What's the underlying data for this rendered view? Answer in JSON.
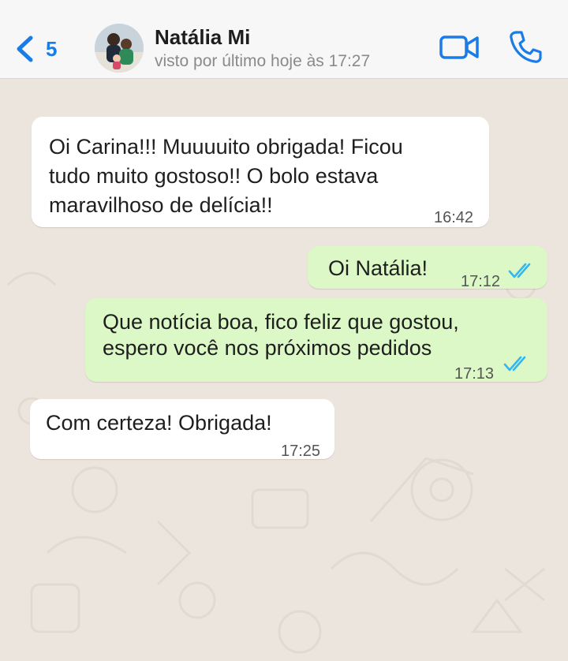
{
  "header": {
    "back_count": "5",
    "contact_name": "Natália Mi",
    "status": "visto por último hoje às 17:27"
  },
  "colors": {
    "accent": "#1a7ce6",
    "incoming_bubble": "#ffffff",
    "outgoing_bubble": "#dcf8c6",
    "chat_background": "#ece5dd",
    "read_ticks": "#34b7f1"
  },
  "icons": {
    "back": "chevron-left-icon",
    "video": "video-camera-icon",
    "call": "phone-icon",
    "read_receipt": "double-check-icon"
  },
  "messages": [
    {
      "direction": "incoming",
      "lines": [
        "Oi Carina!!! Muuuuito obrigada! Ficou",
        "tudo muito gostoso!! O bolo estava",
        "maravilhoso de delícia!!"
      ],
      "time": "16:42"
    },
    {
      "direction": "outgoing",
      "lines": [
        "Oi Natália!"
      ],
      "time": "17:12",
      "read": true
    },
    {
      "direction": "outgoing",
      "lines": [
        "Que notícia boa, fico feliz que gostou,",
        "espero você nos próximos pedidos"
      ],
      "time": "17:13",
      "read": true
    },
    {
      "direction": "incoming",
      "lines": [
        "Com certeza! Obrigada!"
      ],
      "time": "17:25"
    }
  ]
}
